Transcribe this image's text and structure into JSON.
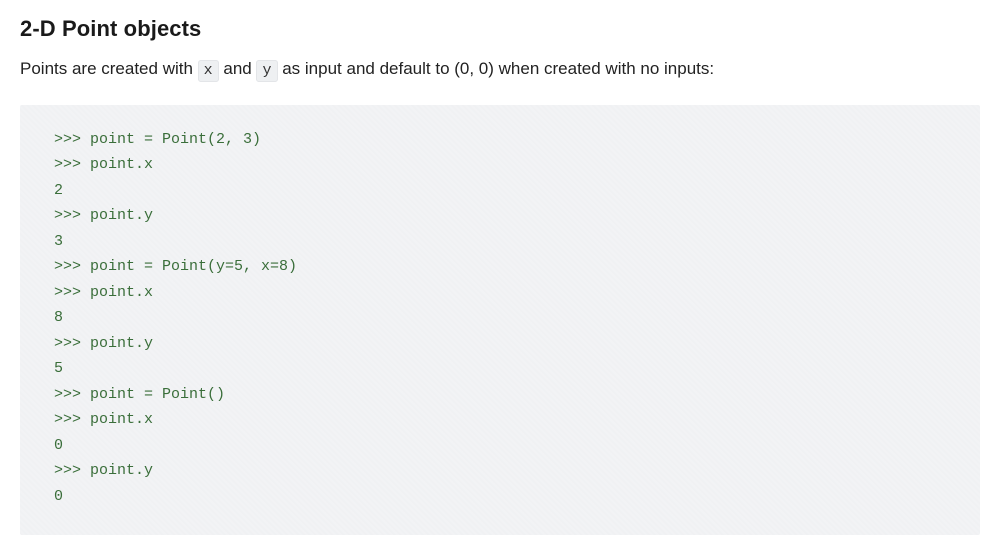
{
  "heading": "2-D Point objects",
  "intro": {
    "t1": "Points are created with ",
    "code1": "x",
    "t2": " and ",
    "code2": "y",
    "t3": " as input and default to (0, 0) when created with no inputs:"
  },
  "code": ">>> point = Point(2, 3)\n>>> point.x\n2\n>>> point.y\n3\n>>> point = Point(y=5, x=8)\n>>> point.x\n8\n>>> point.y\n5\n>>> point = Point()\n>>> point.x\n0\n>>> point.y\n0"
}
